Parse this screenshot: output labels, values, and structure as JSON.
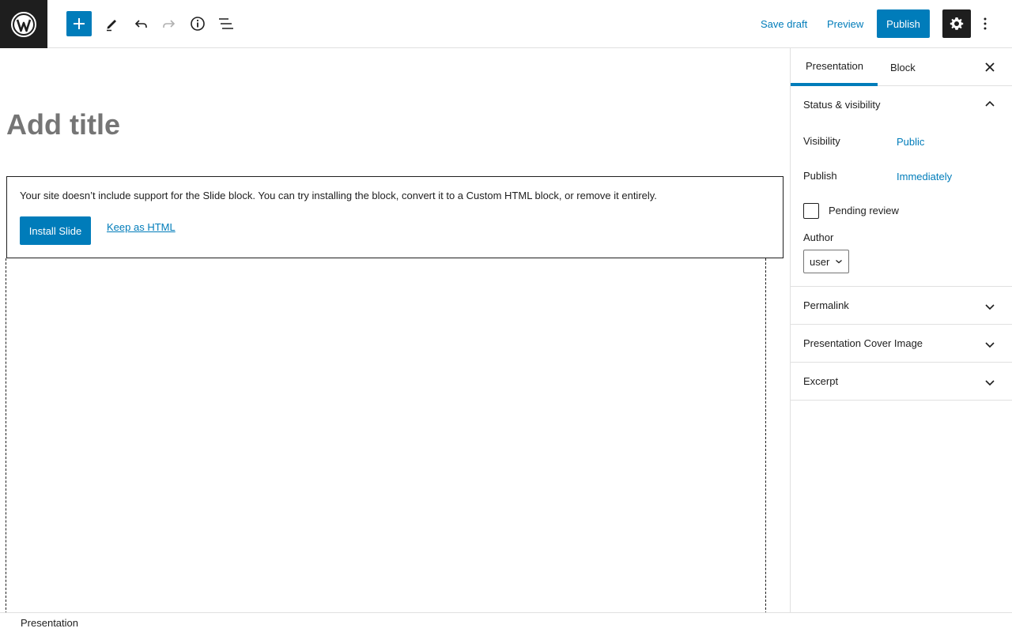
{
  "toolbar": {
    "logo_icon": "wordpress-logo-icon",
    "add_icon": "plus-icon",
    "edit_icon": "pencil-icon",
    "undo_icon": "undo-icon",
    "redo_icon": "redo-icon",
    "info_icon": "info-icon",
    "list_view_icon": "list-view-icon",
    "save_draft_label": "Save draft",
    "preview_label": "Preview",
    "publish_label": "Publish",
    "settings_icon": "gear-icon",
    "more_icon": "more-vertical-icon"
  },
  "editor": {
    "title_placeholder": "Add title",
    "missing_block": {
      "message": "Your site doesn’t include support for the Slide block. You can try installing the block, convert it to a Custom HTML block, or remove it entirely.",
      "install_label": "Install Slide",
      "keep_html_label": "Keep as HTML"
    }
  },
  "sidebar": {
    "tabs": [
      {
        "label": "Presentation",
        "active": true
      },
      {
        "label": "Block",
        "active": false
      }
    ],
    "close_icon": "close-icon",
    "status_panel": {
      "title": "Status & visibility",
      "expanded": true,
      "visibility_label": "Visibility",
      "visibility_value": "Public",
      "publish_label": "Publish",
      "publish_value": "Immediately",
      "pending_review_label": "Pending review",
      "pending_review_checked": false,
      "author_label": "Author",
      "author_value": "user"
    },
    "panels": [
      {
        "title": "Permalink",
        "expanded": false
      },
      {
        "title": "Presentation Cover Image",
        "expanded": false
      },
      {
        "title": "Excerpt",
        "expanded": false
      }
    ]
  },
  "footer": {
    "breadcrumb": "Presentation"
  },
  "colors": {
    "accent": "#007cba",
    "dark": "#1e1e1e",
    "border": "#e0e0e0"
  }
}
